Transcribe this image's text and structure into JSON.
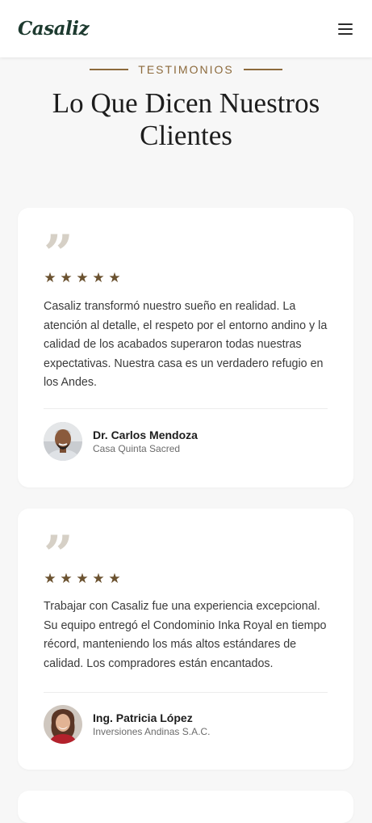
{
  "header": {
    "logo": "Casaliz",
    "menu_icon": "hamburger-menu-icon"
  },
  "section": {
    "eyebrow": "TESTIMONIOS",
    "title": "Lo Que Dicen Nuestros Clientes"
  },
  "testimonials": [
    {
      "quote_icon": "quote-icon",
      "rating": 5,
      "stars": "★★★★★",
      "text": "Casaliz transformó nuestro sueño en realidad. La atención al detalle, el respeto por el entorno andino y la calidad de los acabados superaron todas nuestras expectativas. Nuestra casa es un verdadero refugio en los Andes.",
      "name": "Dr. Carlos Mendoza",
      "company": "Casa Quinta Sacred"
    },
    {
      "quote_icon": "quote-icon",
      "rating": 5,
      "stars": "★★★★★",
      "text": "Trabajar con Casaliz fue una experiencia excepcional. Su equipo entregó el Condominio Inka Royal en tiempo récord, manteniendo los más altos estándares de calidad. Los compradores están encantados.",
      "name": "Ing. Patricia López",
      "company": "Inversiones Andinas S.A.C."
    }
  ],
  "colors": {
    "accent": "#8c6a3c",
    "star": "#6b5230",
    "logo": "#1d3a2f",
    "background": "#f7f7f7"
  }
}
